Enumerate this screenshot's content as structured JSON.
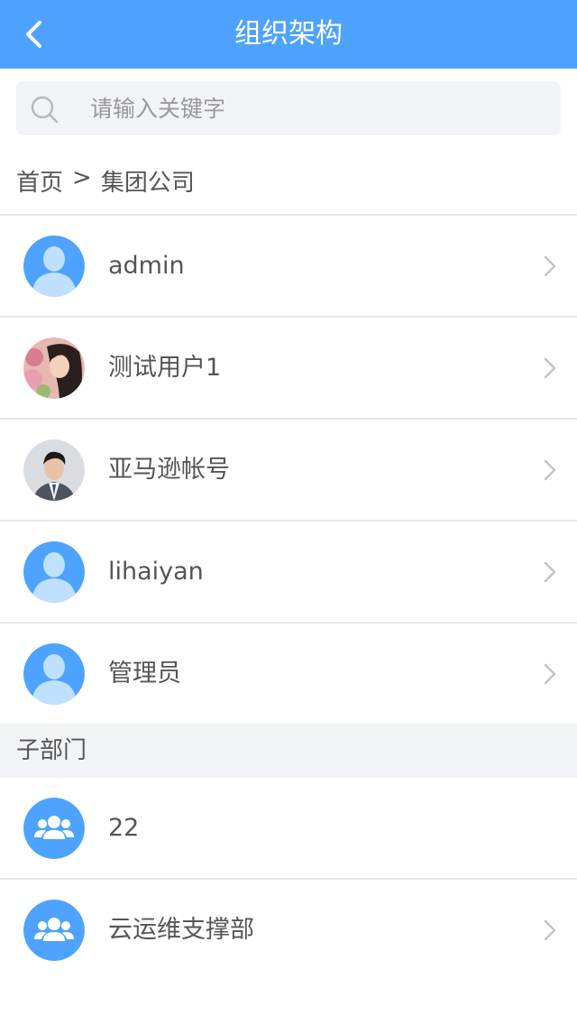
{
  "header": {
    "title": "组织架构",
    "back_icon": "back-arrow-icon"
  },
  "search": {
    "placeholder": "请输入关键字",
    "value": "",
    "icon": "search-icon"
  },
  "breadcrumb": {
    "home": "首页",
    "separator": ">",
    "current": "集团公司"
  },
  "users": [
    {
      "name": "admin",
      "avatar": "default-avatar"
    },
    {
      "name": "测试用户1",
      "avatar": "photo-avatar"
    },
    {
      "name": "亚马逊帐号",
      "avatar": "photo-avatar"
    },
    {
      "name": "lihaiyan",
      "avatar": "default-avatar"
    },
    {
      "name": "管理员",
      "avatar": "default-avatar"
    }
  ],
  "sub_departments": {
    "title": "子部门",
    "items": [
      {
        "name": "22",
        "icon": "group-icon",
        "has_chevron": false
      },
      {
        "name": "云运维支撑部",
        "icon": "group-icon",
        "has_chevron": true
      }
    ]
  },
  "colors": {
    "primary": "#4da3ff",
    "avatar_bg": "#4da3ff",
    "section_bg": "#f2f3f6"
  }
}
